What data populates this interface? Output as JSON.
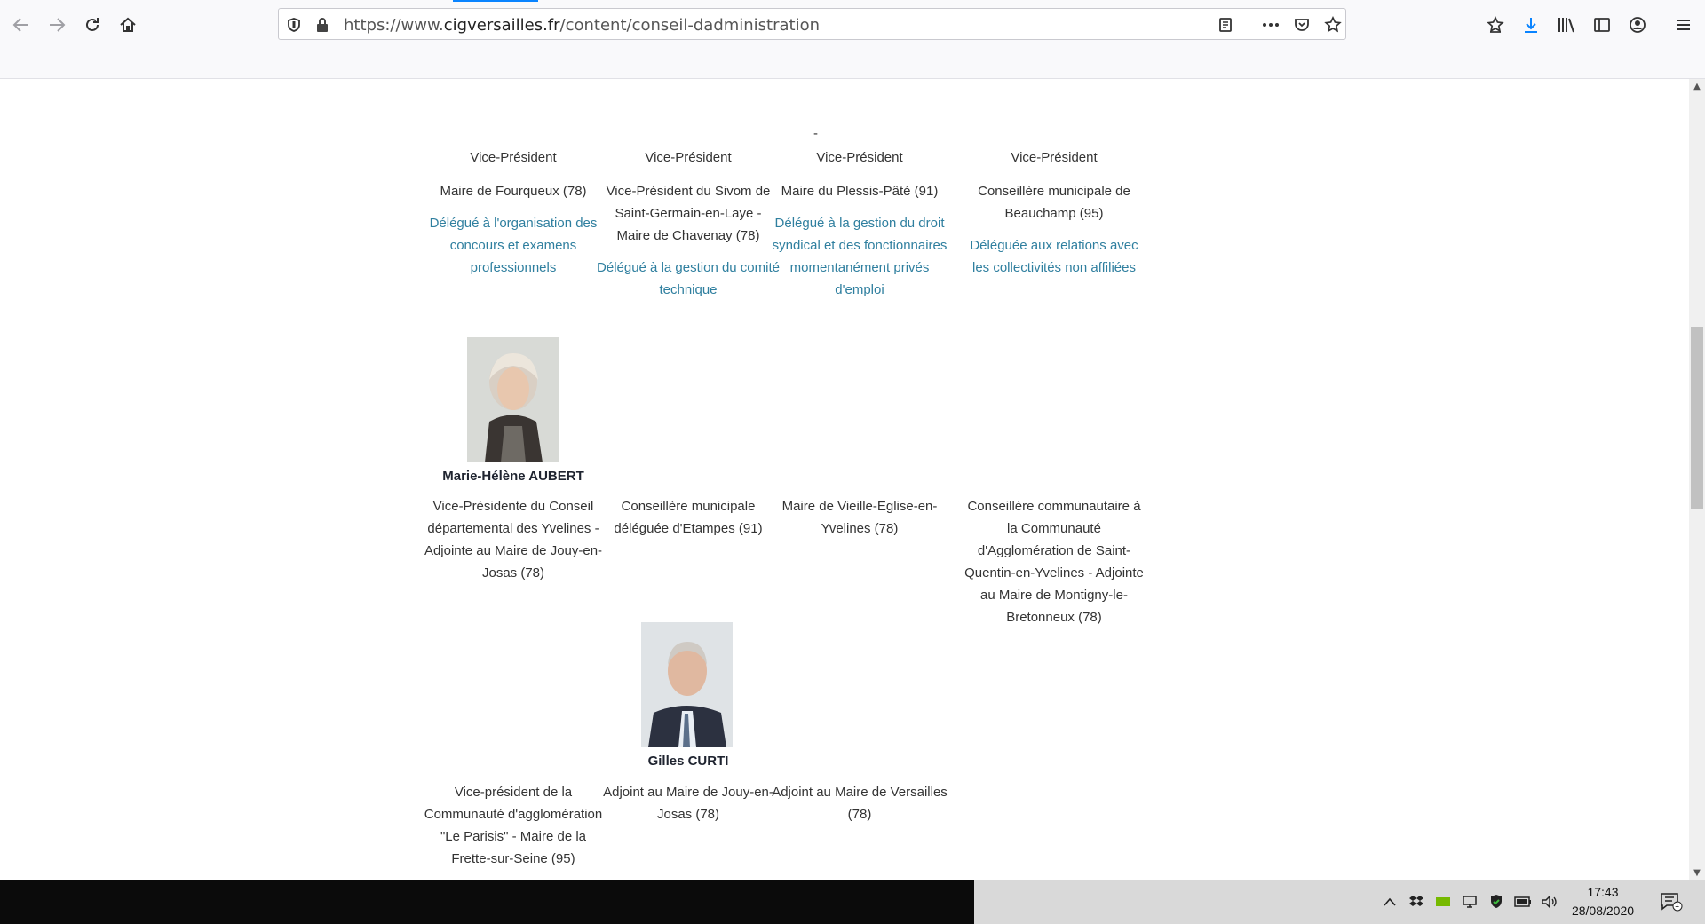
{
  "browser": {
    "url_prefix": "https://www.",
    "url_domain": "cigversailles.fr",
    "url_path": "/content/conseil-dadministration",
    "accent": "#0a84ff"
  },
  "page": {
    "link_color": "#2f7f9f",
    "row1": [
      {
        "role": "Vice-Président",
        "desc": "Maire de Fourqueux (78)",
        "deleg": "Délégué à l'organisation des concours et examens professionnels"
      },
      {
        "role": "Vice-Président",
        "desc": "Vice-Président du Sivom de Saint-Germain-en-Laye - Maire de Chavenay (78)",
        "deleg": "Délégué à la gestion du comité technique"
      },
      {
        "role": "Vice-Président",
        "desc": "Maire du Plessis-Pâté (91)",
        "deleg": "Délégué à la gestion du droit syndical et des fonctionnaires momentanément privés d'emploi",
        "dash": "-"
      },
      {
        "role": "Vice-Président",
        "desc": "Conseillère municipale de Beauchamp (95)",
        "deleg": "Déléguée aux relations avec les collectivités non affiliées"
      }
    ],
    "row2": [
      {
        "name": "Marie-Hélène AUBERT",
        "desc": "Vice-Présidente du Conseil départemental des Yvelines - Adjointe au Maire de Jouy-en-Josas (78)"
      },
      {
        "desc": "Conseillère municipale déléguée d'Etampes (91)"
      },
      {
        "desc": "Maire de Vieille-Eglise-en-Yvelines (78)"
      },
      {
        "desc": "Conseillère communautaire à la Communauté d'Agglomération de Saint-Quentin-en-Yvelines - Adjointe au Maire de Montigny-le-Bretonneux (78)"
      }
    ],
    "row3": [
      {
        "desc": "Vice-président de la Communauté d'agglomération \"Le Parisis\" - Maire de la Frette-sur-Seine (95)"
      },
      {
        "name": "Gilles CURTI",
        "desc": "Adjoint au Maire de Jouy-en-Josas (78)"
      },
      {
        "desc": "Adjoint au Maire de Versailles (78)"
      }
    ]
  },
  "taskbar": {
    "time": "17:43",
    "date": "28/08/2020",
    "notifications": "1"
  }
}
